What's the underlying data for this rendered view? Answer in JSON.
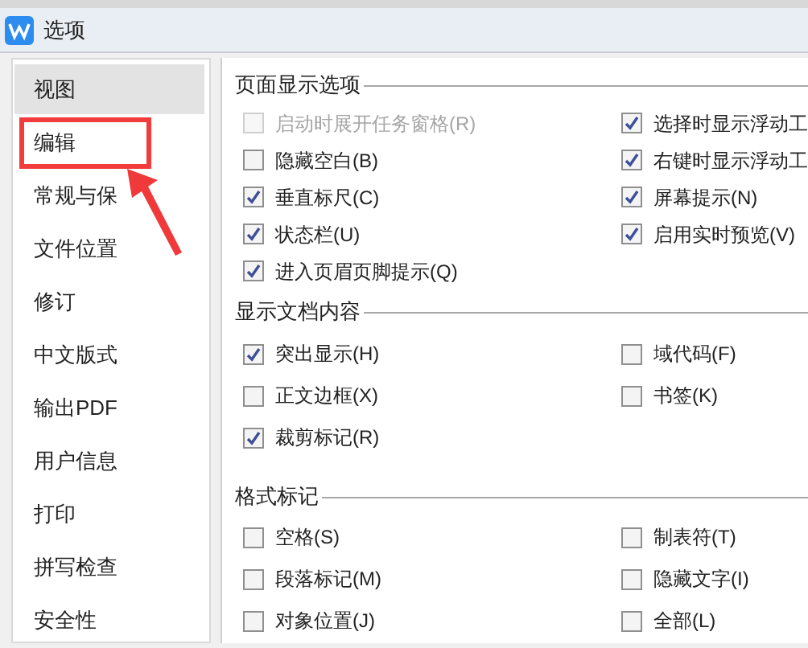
{
  "window": {
    "title": "选项"
  },
  "sidebar": {
    "items": [
      {
        "label": "视图",
        "selected": true,
        "annotated": false
      },
      {
        "label": "编辑",
        "selected": false,
        "annotated": true
      },
      {
        "label": "常规与保",
        "selected": false,
        "annotated": false
      },
      {
        "label": "文件位置",
        "selected": false,
        "annotated": false
      },
      {
        "label": "修订",
        "selected": false,
        "annotated": false
      },
      {
        "label": "中文版式",
        "selected": false,
        "annotated": false
      },
      {
        "label": "输出PDF",
        "selected": false,
        "annotated": false
      },
      {
        "label": "用户信息",
        "selected": false,
        "annotated": false
      },
      {
        "label": "打印",
        "selected": false,
        "annotated": false
      },
      {
        "label": "拼写检查",
        "selected": false,
        "annotated": false
      },
      {
        "label": "安全性",
        "selected": false,
        "annotated": false
      }
    ]
  },
  "sections": [
    {
      "title": "页面显示选项",
      "columns": [
        [
          {
            "label": "启动时展开任务窗格(R)",
            "checked": false,
            "disabled": true
          },
          {
            "label": "隐藏空白(B)",
            "checked": false,
            "disabled": false
          },
          {
            "label": "垂直标尺(C)",
            "checked": true,
            "disabled": false
          },
          {
            "label": "状态栏(U)",
            "checked": true,
            "disabled": false
          },
          {
            "label": "进入页眉页脚提示(Q)",
            "checked": true,
            "disabled": false
          }
        ],
        [
          {
            "label": "选择时显示浮动工",
            "checked": true,
            "disabled": false
          },
          {
            "label": "右键时显示浮动工",
            "checked": true,
            "disabled": false
          },
          {
            "label": "屏幕提示(N)",
            "checked": true,
            "disabled": false
          },
          {
            "label": "启用实时预览(V)",
            "checked": true,
            "disabled": false
          }
        ]
      ]
    },
    {
      "title": "显示文档内容",
      "columns": [
        [
          {
            "label": "突出显示(H)",
            "checked": true,
            "disabled": false
          },
          {
            "label": "正文边框(X)",
            "checked": false,
            "disabled": false
          },
          {
            "label": "裁剪标记(R)",
            "checked": true,
            "disabled": false
          }
        ],
        [
          {
            "label": "域代码(F)",
            "checked": false,
            "disabled": false
          },
          {
            "label": "书签(K)",
            "checked": false,
            "disabled": false
          }
        ]
      ]
    },
    {
      "title": "格式标记",
      "columns": [
        [
          {
            "label": "空格(S)",
            "checked": false,
            "disabled": false
          },
          {
            "label": "段落标记(M)",
            "checked": false,
            "disabled": false
          },
          {
            "label": "对象位置(J)",
            "checked": false,
            "disabled": false
          }
        ],
        [
          {
            "label": "制表符(T)",
            "checked": false,
            "disabled": false
          },
          {
            "label": "隐藏文字(I)",
            "checked": false,
            "disabled": false
          },
          {
            "label": "全部(L)",
            "checked": false,
            "disabled": false
          }
        ]
      ]
    }
  ]
}
